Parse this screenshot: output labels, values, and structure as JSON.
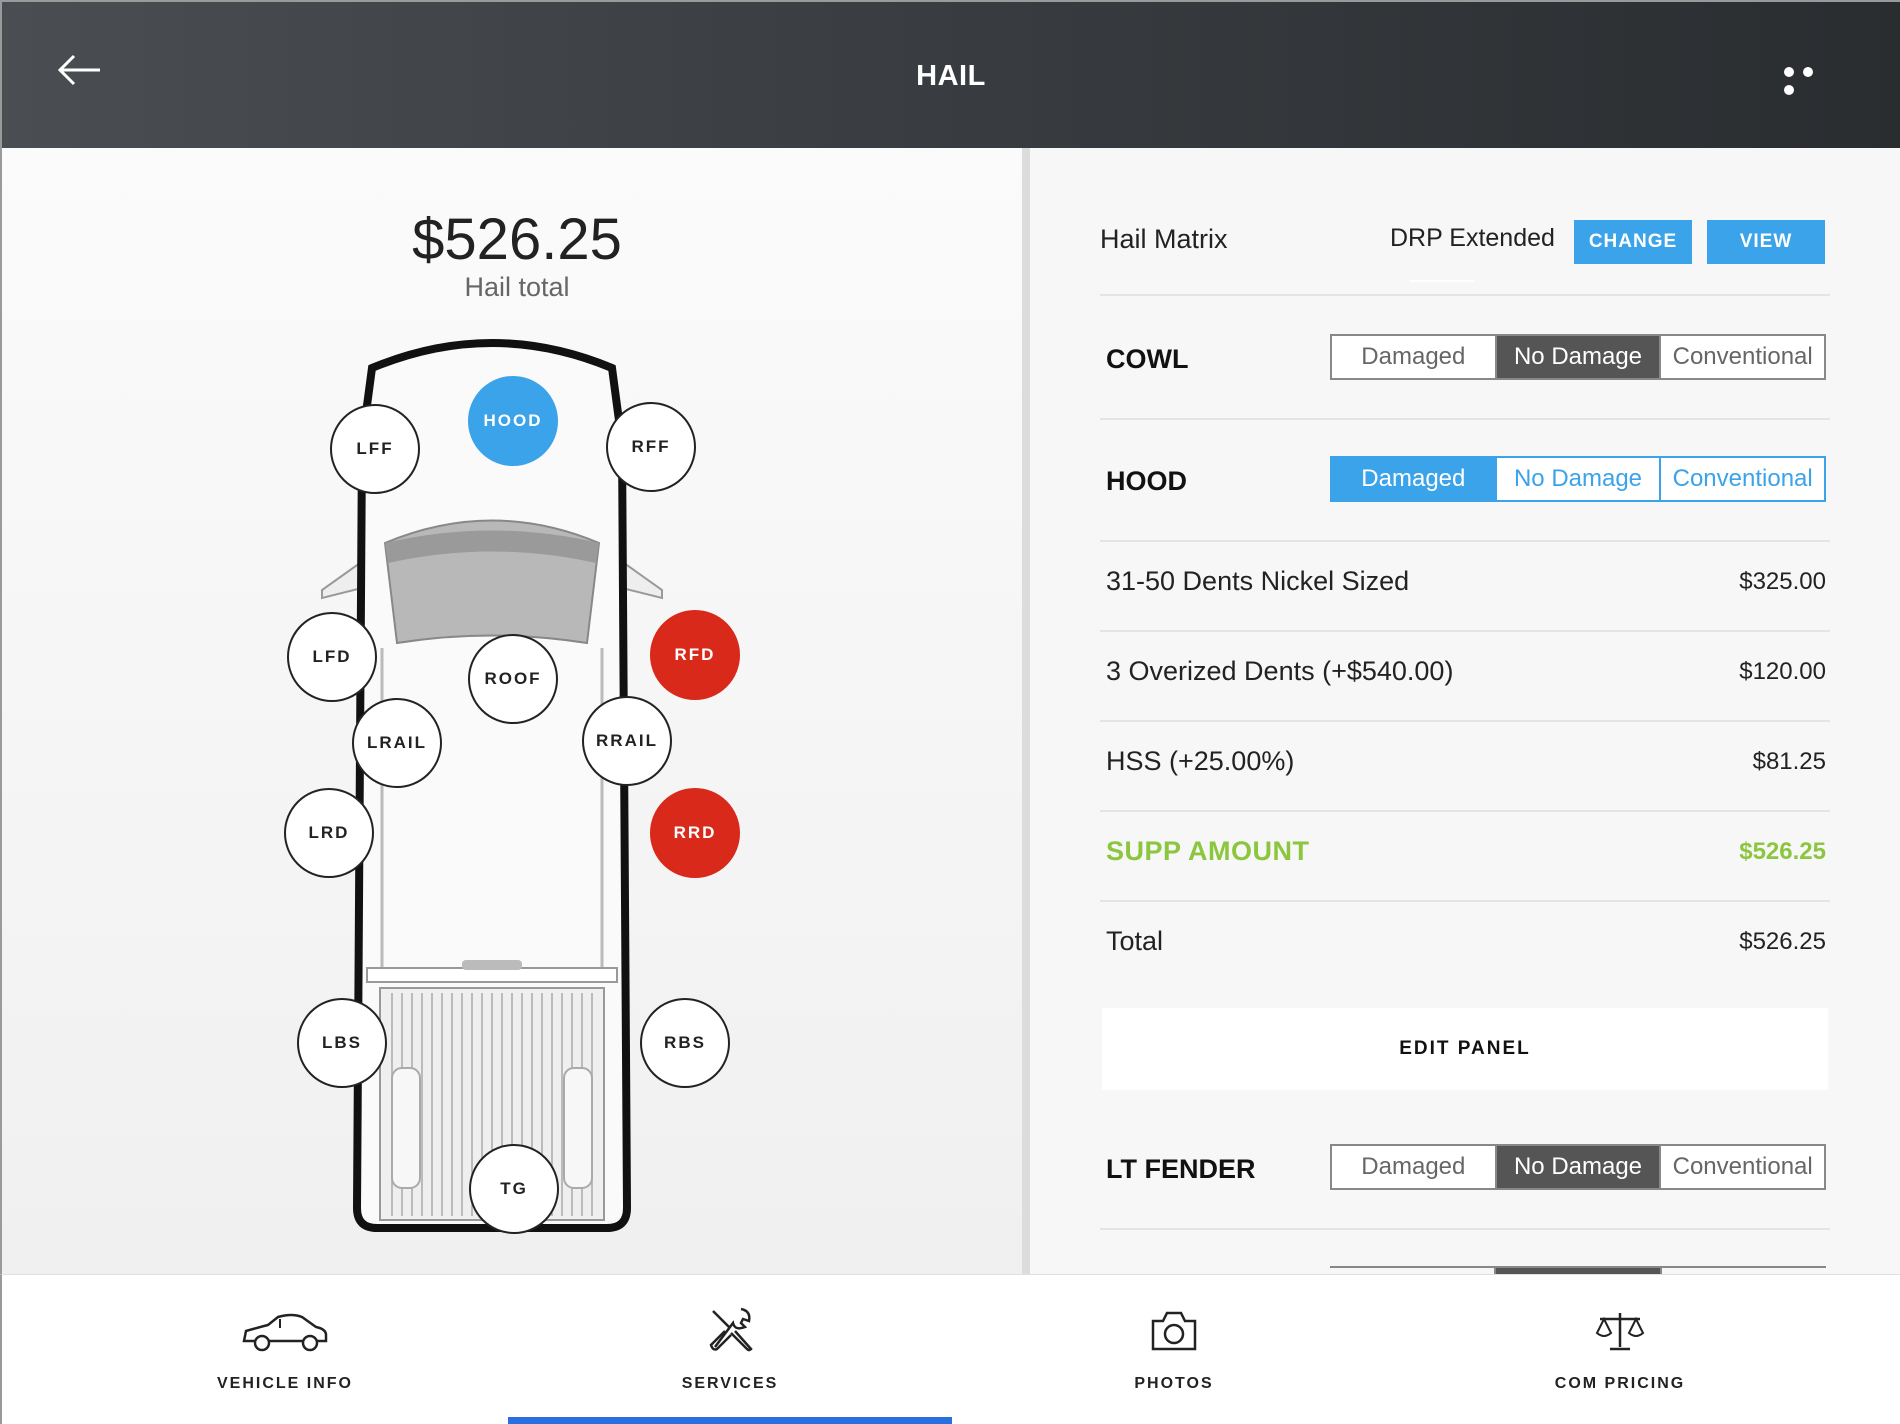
{
  "header": {
    "title": "HAIL",
    "back_icon": "arrow-left-icon",
    "more_icon": "more-dots-icon"
  },
  "summary": {
    "total": "$526.25",
    "total_label": "Hail total"
  },
  "diagram": {
    "spots": [
      {
        "label": "HOOD",
        "state": "blue"
      },
      {
        "label": "LFF",
        "state": "none"
      },
      {
        "label": "RFF",
        "state": "none"
      },
      {
        "label": "LFD",
        "state": "none"
      },
      {
        "label": "ROOF",
        "state": "none"
      },
      {
        "label": "RFD",
        "state": "red"
      },
      {
        "label": "LRAIL",
        "state": "none"
      },
      {
        "label": "RRAIL",
        "state": "none"
      },
      {
        "label": "LRD",
        "state": "none"
      },
      {
        "label": "RRD",
        "state": "red"
      },
      {
        "label": "LBS",
        "state": "none"
      },
      {
        "label": "RBS",
        "state": "none"
      },
      {
        "label": "TG",
        "state": "none"
      }
    ],
    "colors": {
      "selected": "#3aa3ea",
      "damaged": "#d8291b"
    }
  },
  "matrix": {
    "label": "Hail Matrix",
    "value": "DRP Extended",
    "change_label": "CHANGE",
    "view_label": "VIEW"
  },
  "panels": {
    "cowl": {
      "label": "COWL",
      "options": [
        "Damaged",
        "No Damage",
        "Conventional"
      ],
      "selected": "No Damage"
    },
    "hood": {
      "label": "HOOD",
      "options": [
        "Damaged",
        "No Damage",
        "Conventional"
      ],
      "selected": "Damaged"
    },
    "lt_fender": {
      "label": "LT FENDER",
      "options": [
        "Damaged",
        "No Damage",
        "Conventional"
      ],
      "selected": "No Damage"
    }
  },
  "line_items": [
    {
      "label": "31-50 Dents Nickel Sized",
      "amount": "$325.00"
    },
    {
      "label": "3 Overized Dents (+$540.00)",
      "amount": "$120.00"
    },
    {
      "label": "HSS (+25.00%)",
      "amount": "$81.25"
    },
    {
      "label": "SUPP AMOUNT",
      "amount": "$526.25"
    },
    {
      "label": "Total",
      "amount": "$526.25"
    }
  ],
  "edit_panel_label": "EDIT PANEL",
  "nav": {
    "items": [
      {
        "label": "VEHICLE INFO",
        "icon": "car-icon"
      },
      {
        "label": "SERVICES",
        "icon": "tools-icon"
      },
      {
        "label": "PHOTOS",
        "icon": "camera-icon"
      },
      {
        "label": "COM PRICING",
        "icon": "scale-icon"
      }
    ],
    "active": "SERVICES",
    "active_color": "#2a6fe0"
  },
  "accent_colors": {
    "blue": "#3aa3ea",
    "green": "#8cc63f",
    "red": "#d8291b"
  }
}
